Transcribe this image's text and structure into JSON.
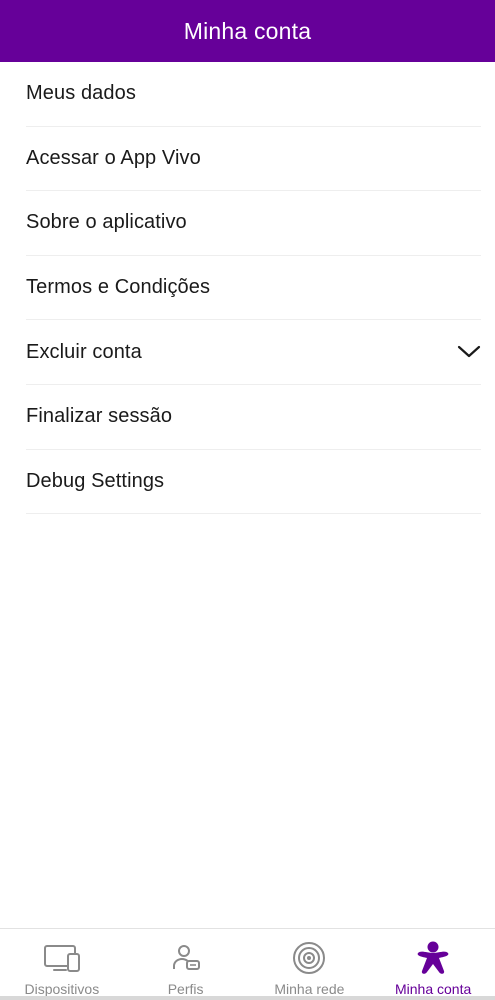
{
  "header": {
    "title": "Minha conta"
  },
  "menu": {
    "items": [
      {
        "label": "Meus dados"
      },
      {
        "label": "Acessar o App Vivo"
      },
      {
        "label": "Sobre o aplicativo"
      },
      {
        "label": "Termos e Condições"
      },
      {
        "label": "Excluir conta",
        "icon": "chevron-down-icon"
      },
      {
        "label": "Finalizar sessão"
      },
      {
        "label": "Debug Settings"
      }
    ]
  },
  "tabbar": {
    "tabs": [
      {
        "label": "Dispositivos",
        "icon": "devices-icon",
        "active": false
      },
      {
        "label": "Perfis",
        "icon": "profiles-icon",
        "active": false
      },
      {
        "label": "Minha rede",
        "icon": "network-icon",
        "active": false
      },
      {
        "label": "Minha conta",
        "icon": "vivo-account-icon",
        "active": true
      }
    ]
  },
  "colors": {
    "brand": "#660099",
    "inactive": "#8a8a8a",
    "divider": "#eeeeee"
  }
}
